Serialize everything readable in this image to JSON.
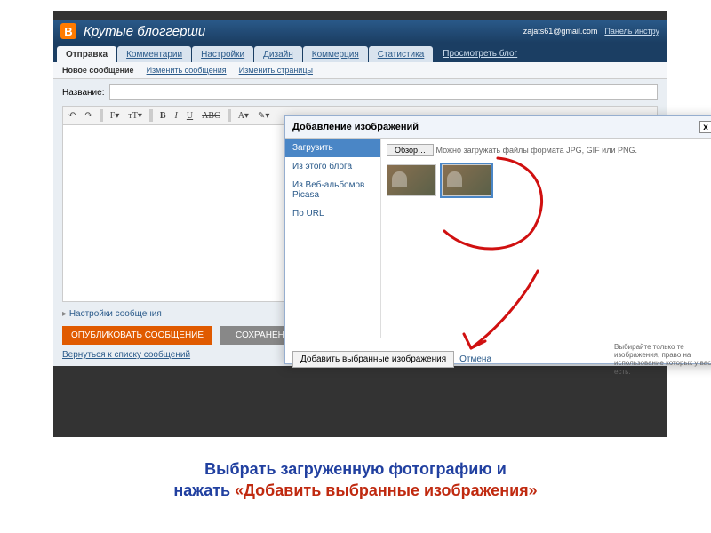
{
  "header": {
    "blog_title": "Крутые блоггерши",
    "user_email": "zajats61@gmail.com",
    "panel_link": "Панель инстру"
  },
  "tabs": {
    "items": [
      "Отправка",
      "Комментарии",
      "Настройки",
      "Дизайн",
      "Коммерция",
      "Статистика"
    ],
    "view_blog": "Просмотреть блог"
  },
  "subtabs": {
    "items": [
      "Новое сообщение",
      "Изменить сообщения",
      "Изменить страницы"
    ]
  },
  "editor": {
    "title_label": "Название:",
    "post_settings": "Настройки сообщения",
    "publish": "ОПУБЛИКОВАТЬ СООБЩЕНИЕ",
    "save": "СОХРАНЕНО",
    "return_link": "Вернуться к списку сообщений"
  },
  "modal": {
    "title": "Добавление изображений",
    "close": "x",
    "sidebar": [
      "Загрузить",
      "Из этого блога",
      "Из Веб-альбомов Picasa",
      "По URL"
    ],
    "browse": "Обзор…",
    "hint": "Можно загружать файлы формата JPG, GIF или PNG.",
    "add": "Добавить выбранные изображения",
    "cancel": "Отмена",
    "rights_hint": "Выбирайте только те изображения, право на использование которых у вас есть."
  },
  "caption": {
    "line1_a": "Выбрать загруженную фотографию и",
    "line2_a": "нажать ",
    "line2_b": "«Добавить выбранные изображения»"
  }
}
